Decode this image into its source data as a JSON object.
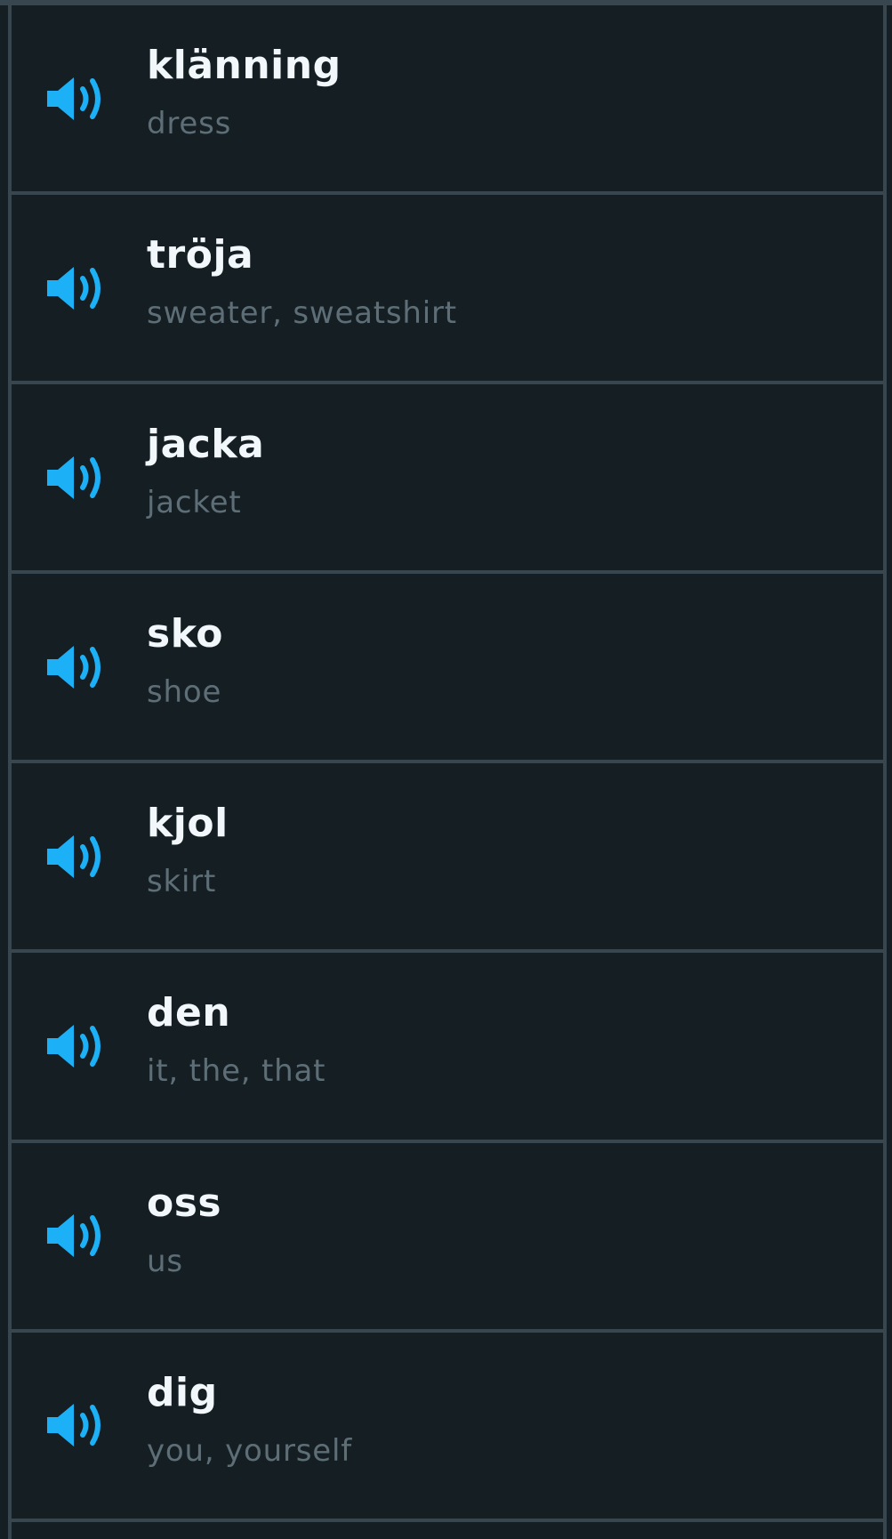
{
  "colors": {
    "background": "#141e23",
    "border": "#37464f",
    "word": "#f1f7fb",
    "meaning": "#5e6e76",
    "speaker_accent": "#1cb0f6"
  },
  "words": [
    {
      "word": "klänning",
      "meaning": "dress",
      "icon": "speaker-icon"
    },
    {
      "word": "tröja",
      "meaning": "sweater, sweatshirt",
      "icon": "speaker-icon"
    },
    {
      "word": "jacka",
      "meaning": "jacket",
      "icon": "speaker-icon"
    },
    {
      "word": "sko",
      "meaning": "shoe",
      "icon": "speaker-icon"
    },
    {
      "word": "kjol",
      "meaning": "skirt",
      "icon": "speaker-icon"
    },
    {
      "word": "den",
      "meaning": "it, the, that",
      "icon": "speaker-icon"
    },
    {
      "word": "oss",
      "meaning": "us",
      "icon": "speaker-icon"
    },
    {
      "word": "dig",
      "meaning": "you, yourself",
      "icon": "speaker-icon"
    }
  ]
}
